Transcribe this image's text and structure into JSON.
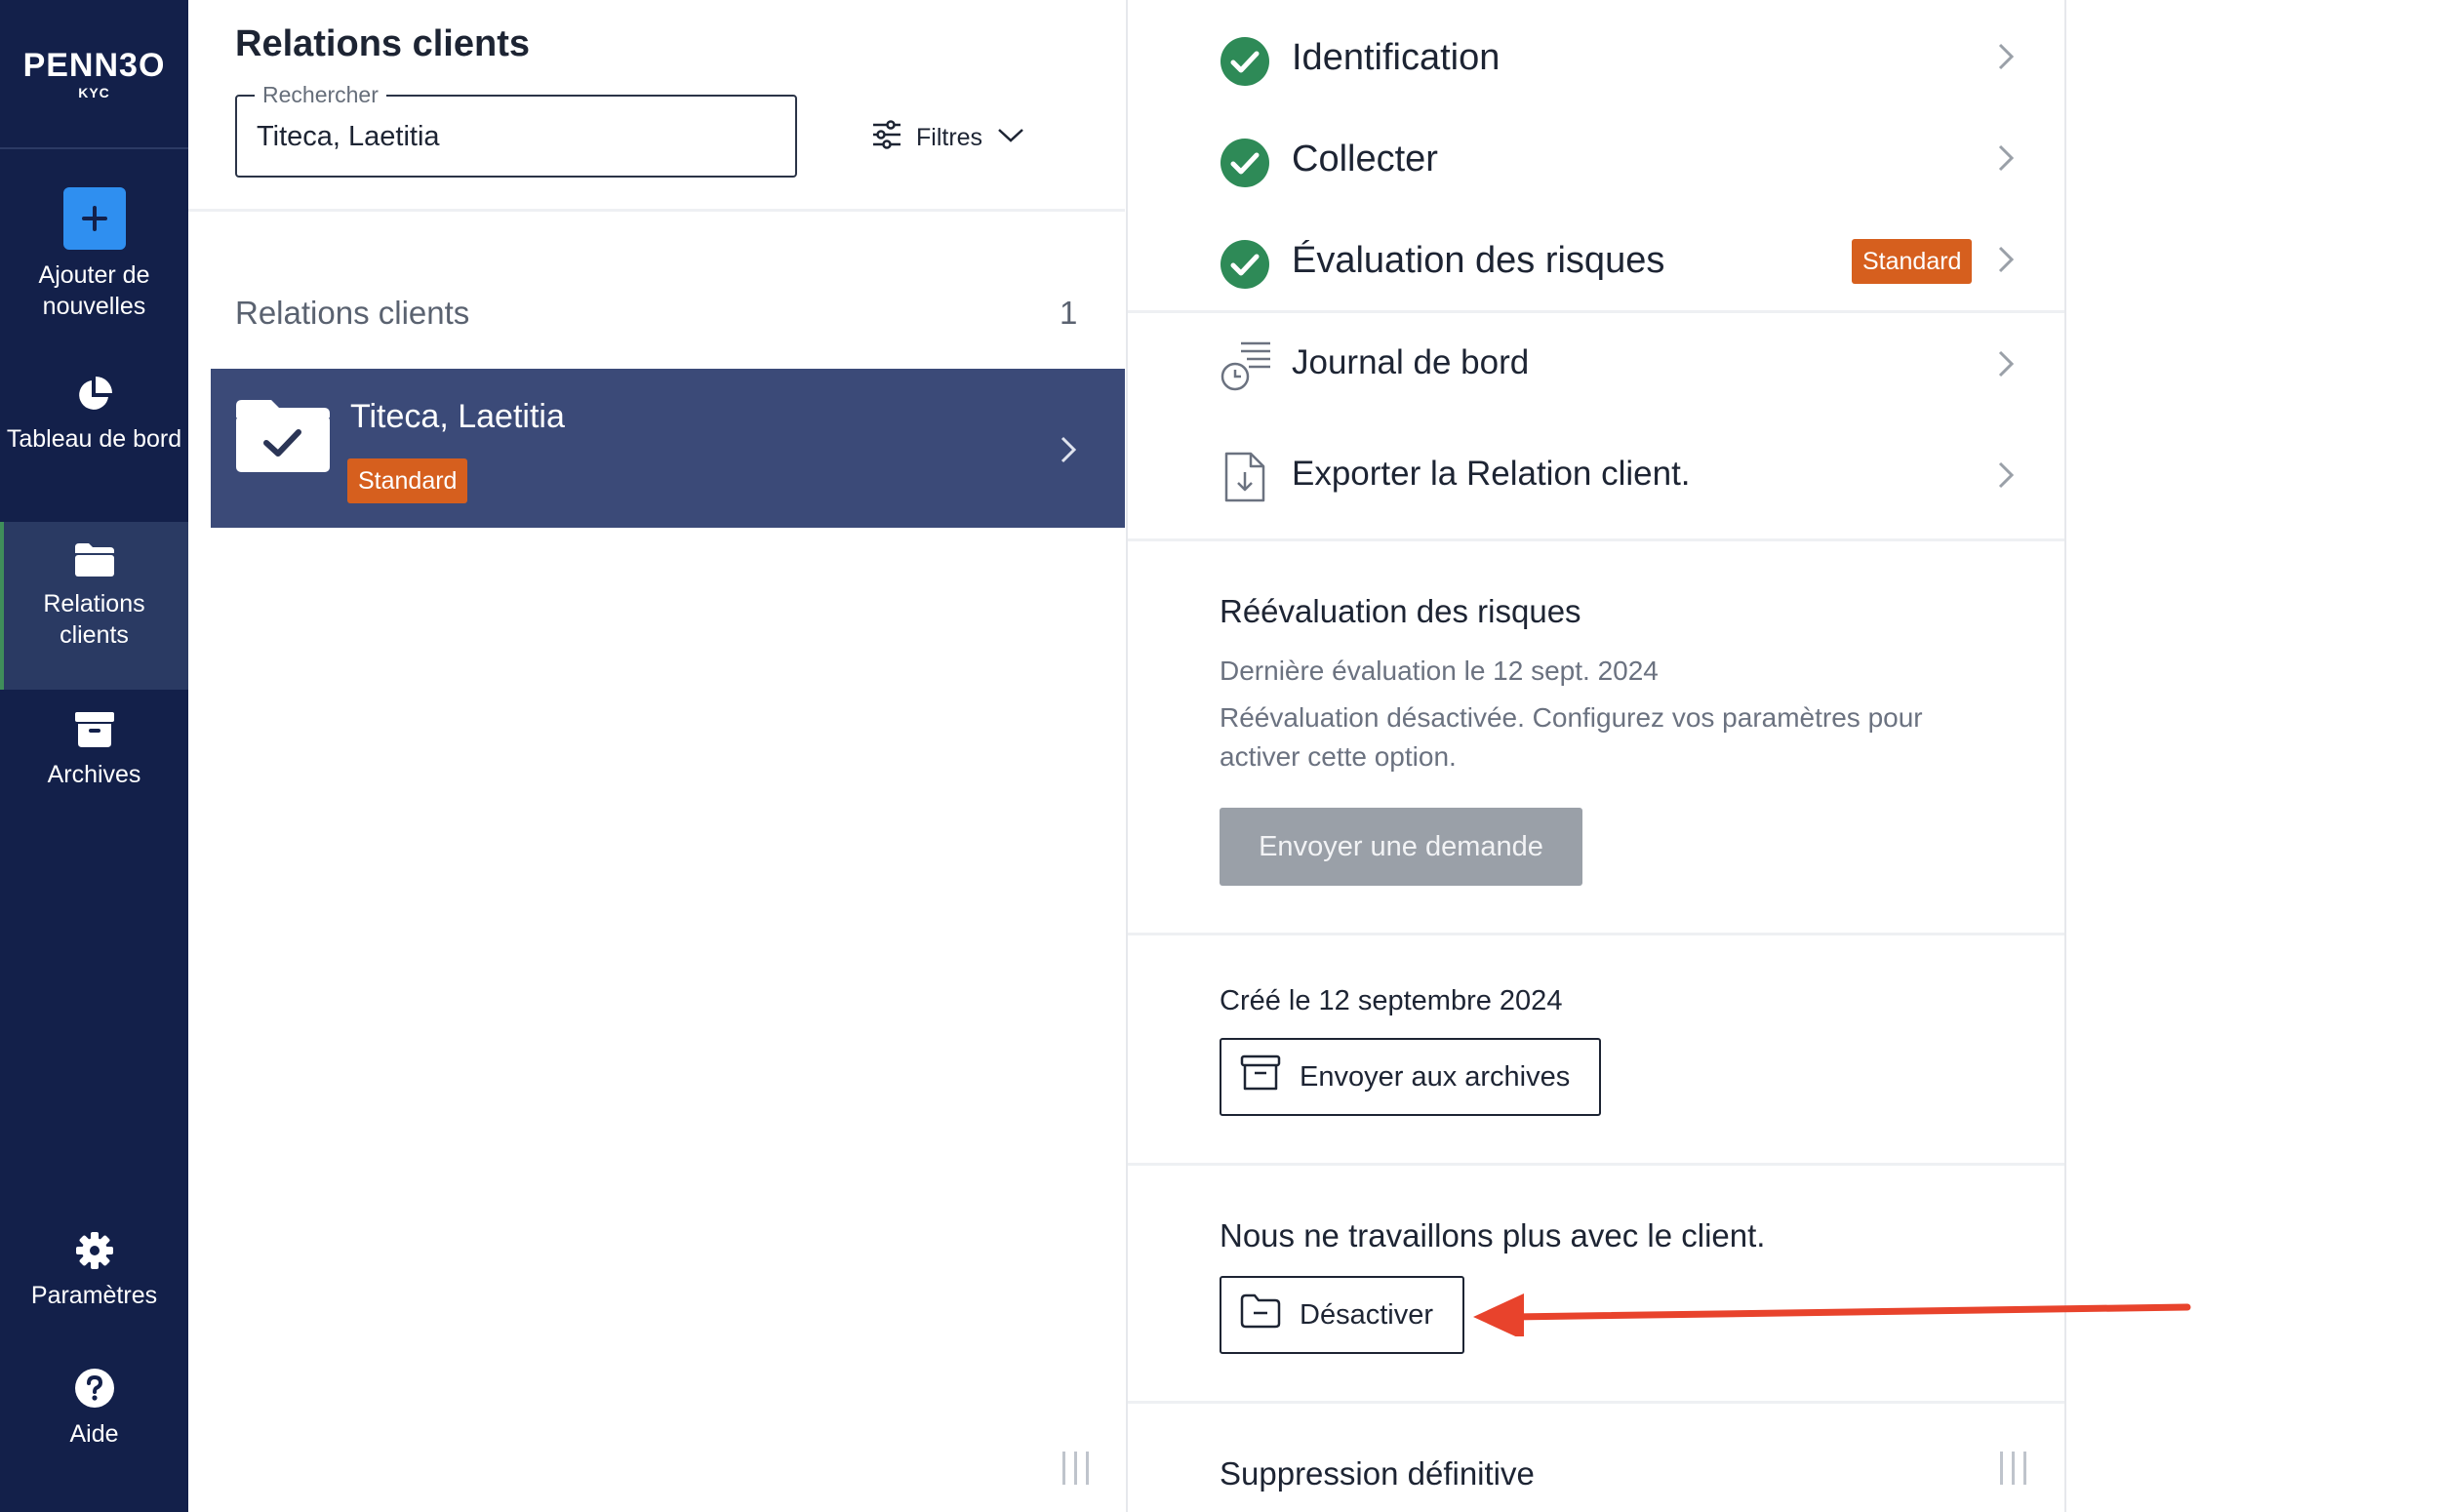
{
  "brand": {
    "name": "PENN3O",
    "sub": "KYC"
  },
  "sidebar": {
    "items": [
      {
        "id": "add",
        "label": "Ajouter de nouvelles"
      },
      {
        "id": "dashboard",
        "label": "Tableau de bord"
      },
      {
        "id": "relations",
        "label": "Relations clients",
        "active": true
      },
      {
        "id": "archives",
        "label": "Archives"
      }
    ],
    "bottom": [
      {
        "id": "settings",
        "label": "Paramètres"
      },
      {
        "id": "help",
        "label": "Aide"
      }
    ]
  },
  "list_panel": {
    "title": "Relations clients",
    "search": {
      "legend": "Rechercher",
      "value": "Titeca, Laetitia"
    },
    "filter_label": "Filtres",
    "list_heading": "Relations clients",
    "count": "1",
    "clients": [
      {
        "name": "Titeca, Laetitia",
        "badge": "Standard",
        "selected": true
      }
    ]
  },
  "detail": {
    "steps": [
      {
        "label": "Identification",
        "status": "done"
      },
      {
        "label": "Collecter",
        "status": "done"
      },
      {
        "label": "Évaluation des risques",
        "status": "done",
        "badge": "Standard"
      }
    ],
    "links": [
      {
        "label": "Journal de bord",
        "icon": "logbook-icon"
      },
      {
        "label": "Exporter la Relation client.",
        "icon": "export-file-icon"
      }
    ],
    "reassessment": {
      "title": "Réévaluation des risques",
      "last": "Dernière évaluation le 12 sept. 2024",
      "note": "Réévaluation désactivée. Configurez vos paramètres pour activer cette option.",
      "button": "Envoyer une demande"
    },
    "created": {
      "text": "Créé le 12 septembre 2024",
      "button": "Envoyer aux archives"
    },
    "deactivate": {
      "title": "Nous ne travaillons plus avec le client.",
      "button": "Désactiver"
    },
    "delete": {
      "title": "Suppression définitive"
    }
  },
  "colors": {
    "sidebar": "#13204a",
    "selected_row": "#3b4a78",
    "badge": "#d65f1e",
    "success": "#2e8a57",
    "accent_add": "#2f8ff0",
    "annotation": "#e8432c"
  }
}
